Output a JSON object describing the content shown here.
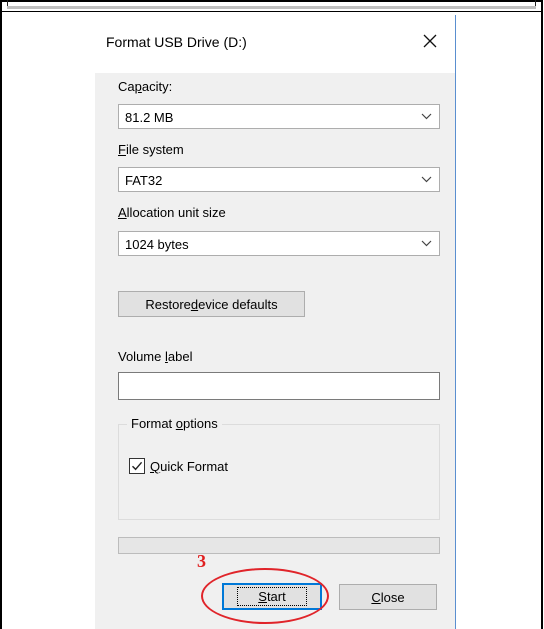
{
  "dialog": {
    "title": "Format USB Drive (D:)",
    "close_icon": "close-icon",
    "capacity": {
      "label_pre": "Ca",
      "label_key": "p",
      "label_post": "acity:",
      "value": "81.2 MB"
    },
    "file_system": {
      "label_key": "F",
      "label_post": "ile system",
      "value": "FAT32"
    },
    "allocation": {
      "label_key": "A",
      "label_post": "llocation unit size",
      "value": "1024 bytes"
    },
    "restore_button": {
      "pre": "Restore ",
      "key": "d",
      "post": "evice defaults"
    },
    "volume_label": {
      "pre": "Volume ",
      "key": "l",
      "post": "abel",
      "value": ""
    },
    "format_options": {
      "title_pre": "Format ",
      "title_key": "o",
      "title_post": "ptions",
      "quick_format": {
        "key": "Q",
        "post": "uick Format",
        "checked": true
      }
    },
    "progress": 0,
    "start_button": {
      "key": "S",
      "post": "tart"
    },
    "close_button": {
      "key": "C",
      "post": "lose"
    }
  },
  "annotation": {
    "step_number": "3",
    "color": "#e0242a"
  },
  "colors": {
    "dialog_bg": "#f0f0f0",
    "titlebar_bg": "#ffffff",
    "window_border": "#5a8fd0",
    "focus_border": "#0078d7"
  }
}
